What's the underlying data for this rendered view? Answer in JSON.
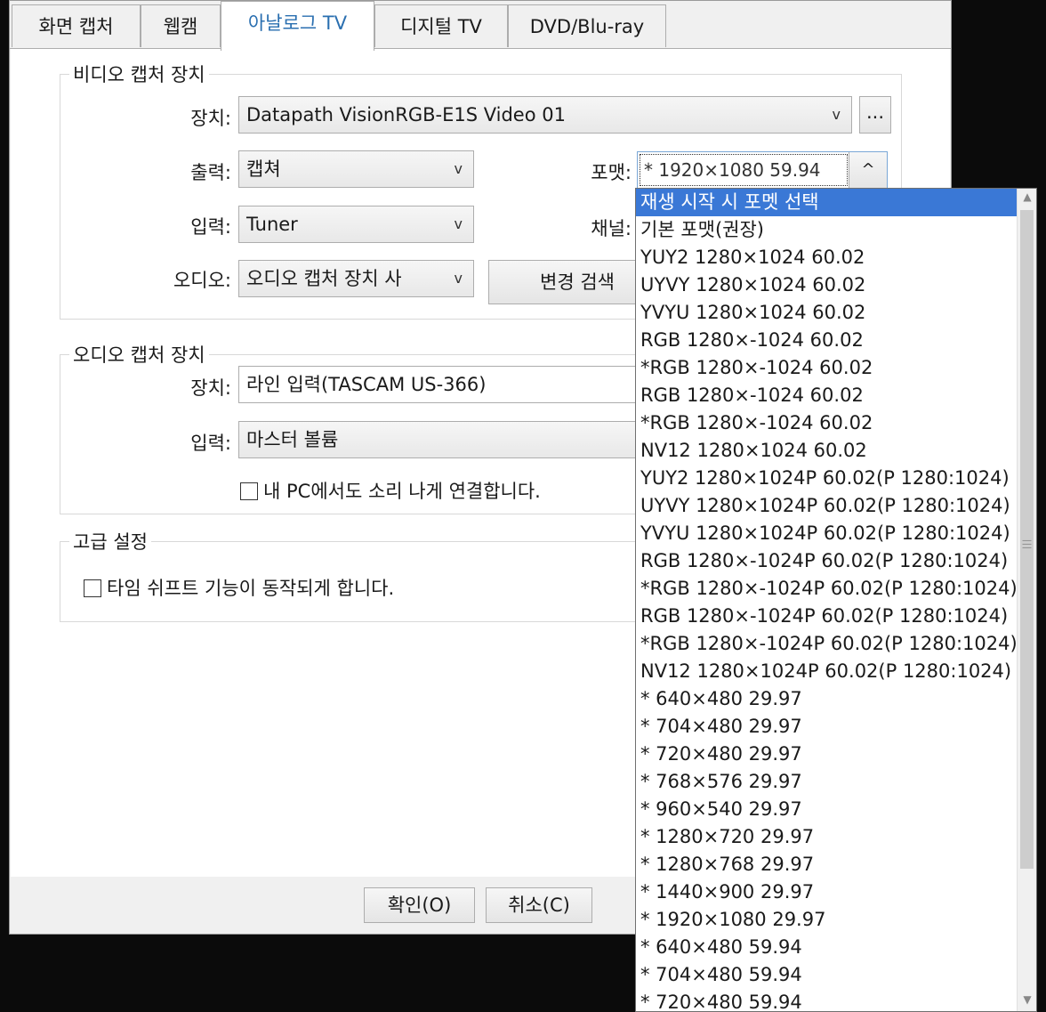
{
  "tabs": [
    "화면 캡처",
    "웹캠",
    "아날로그 TV",
    "디지털 TV",
    "DVD/Blu-ray"
  ],
  "active_tab": "아날로그 TV",
  "video_capture": {
    "legend": "비디오 캡처 장치",
    "device_label": "장치:",
    "device_value": "Datapath VisionRGB-E1S Video 01",
    "browse_label": "...",
    "output_label": "출력:",
    "output_value": "캡쳐",
    "format_label": "포맷:",
    "format_value": "* 1920×1080 59.94",
    "input_label": "입력:",
    "input_value": "Tuner",
    "channel_label": "채널:",
    "audio_label": "오디오:",
    "audio_value": "오디오 캡처 장치 사",
    "change_search_label": "변경 검색"
  },
  "audio_capture": {
    "legend": "오디오 캡처 장치",
    "device_label": "장치:",
    "device_value": "라인 입력(TASCAM US-366)",
    "input_label": "입력:",
    "input_value": "마스터 볼륨",
    "monitor_checkbox": "내 PC에서도 소리 나게 연결합니다."
  },
  "advanced": {
    "legend": "고급 설정",
    "timeshift_checkbox": "타임 쉬프트 기능이 동작되게 합니다."
  },
  "buttons": {
    "ok": "확인(O)",
    "cancel": "취소(C)"
  },
  "arrows": {
    "down": "v",
    "up": "^"
  },
  "format_dropdown": {
    "selected_index": 0,
    "items": [
      "재생 시작 시 포멧 선택",
      "기본 포맷(권장)",
      "YUY2 1280×1024 60.02",
      "UYVY 1280×1024 60.02",
      "YVYU 1280×1024 60.02",
      "RGB 1280×-1024 60.02",
      "*RGB 1280×-1024 60.02",
      "RGB 1280×-1024 60.02",
      "*RGB 1280×-1024 60.02",
      "NV12 1280×1024 60.02",
      "YUY2 1280×1024P 60.02(P 1280:1024)",
      "UYVY 1280×1024P 60.02(P 1280:1024)",
      "YVYU 1280×1024P 60.02(P 1280:1024)",
      "RGB 1280×-1024P 60.02(P 1280:1024)",
      "*RGB 1280×-1024P 60.02(P 1280:1024)",
      "RGB 1280×-1024P 60.02(P 1280:1024)",
      "*RGB 1280×-1024P 60.02(P 1280:1024)",
      "NV12 1280×1024P 60.02(P 1280:1024)",
      "* 640×480 29.97",
      "* 704×480 29.97",
      "* 720×480 29.97",
      "* 768×576 29.97",
      "* 960×540 29.97",
      "* 1280×720 29.97",
      "* 1280×768 29.97",
      "* 1440×900 29.97",
      "* 1920×1080 29.97",
      "* 640×480 59.94",
      "* 704×480 59.94",
      "* 720×480 59.94"
    ]
  },
  "colors": {
    "selection": "#3a78d6",
    "active_tab_text": "#2a6fb0",
    "background": "#0b0b0b"
  }
}
